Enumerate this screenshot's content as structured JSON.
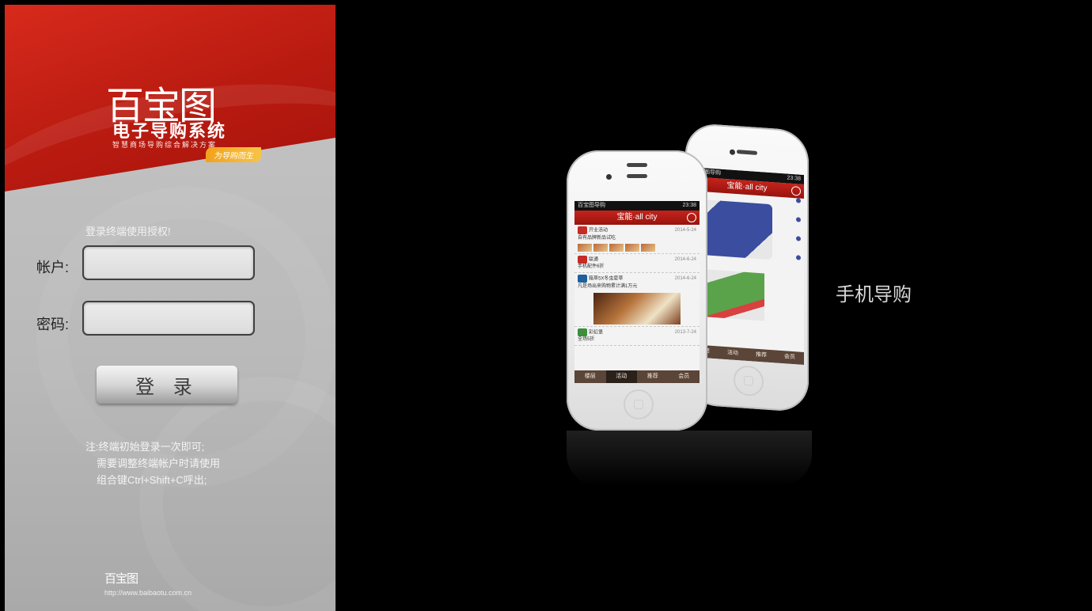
{
  "brand": {
    "logo_text": "百宝图",
    "title": "电子导购系统",
    "subtitle": "智慧商场导购综合解决方案",
    "tagline": "为导购而生"
  },
  "login": {
    "hint": "登录终端使用授权!",
    "account_label": "帐户:",
    "account_value": "",
    "password_label": "密码:",
    "password_value": "",
    "submit_label": "登 录"
  },
  "note": {
    "line1": "注:终端初始登录一次即可;",
    "line2": "需要调整终端帐户时请使用",
    "line3": "组合键Ctrl+Shift+C呼出;"
  },
  "footer": {
    "logo_text": "百宝图",
    "url": "http://www.baibaotu.com.cn"
  },
  "promo": {
    "caption": "手机导购",
    "front_phone": {
      "status_left": "百宝图导购",
      "status_right": "23:38",
      "app_title": "宝能·all city",
      "items": [
        {
          "name": "开业活动",
          "date": "2014-5-24",
          "desc": "自有品牌新品试吃"
        },
        {
          "name": "联通",
          "date": "2014-6-24",
          "desc": "手机配件6折"
        },
        {
          "name": "箱草5X冬虫夏草",
          "date": "2014-6-24",
          "desc": "凡是场出来购物累计满1万元"
        },
        {
          "name": "彩虹堡",
          "date": "2013-7-24",
          "desc": "全场5折"
        }
      ],
      "tabs": [
        "楼层",
        "活动",
        "推荐",
        "会员"
      ],
      "active_tab": "活动"
    },
    "back_phone": {
      "status_left": "百宝图导购",
      "status_right": "23:38",
      "app_title": "宝能·all city",
      "tabs": [
        "楼层",
        "活动",
        "推荐",
        "会员"
      ]
    }
  }
}
